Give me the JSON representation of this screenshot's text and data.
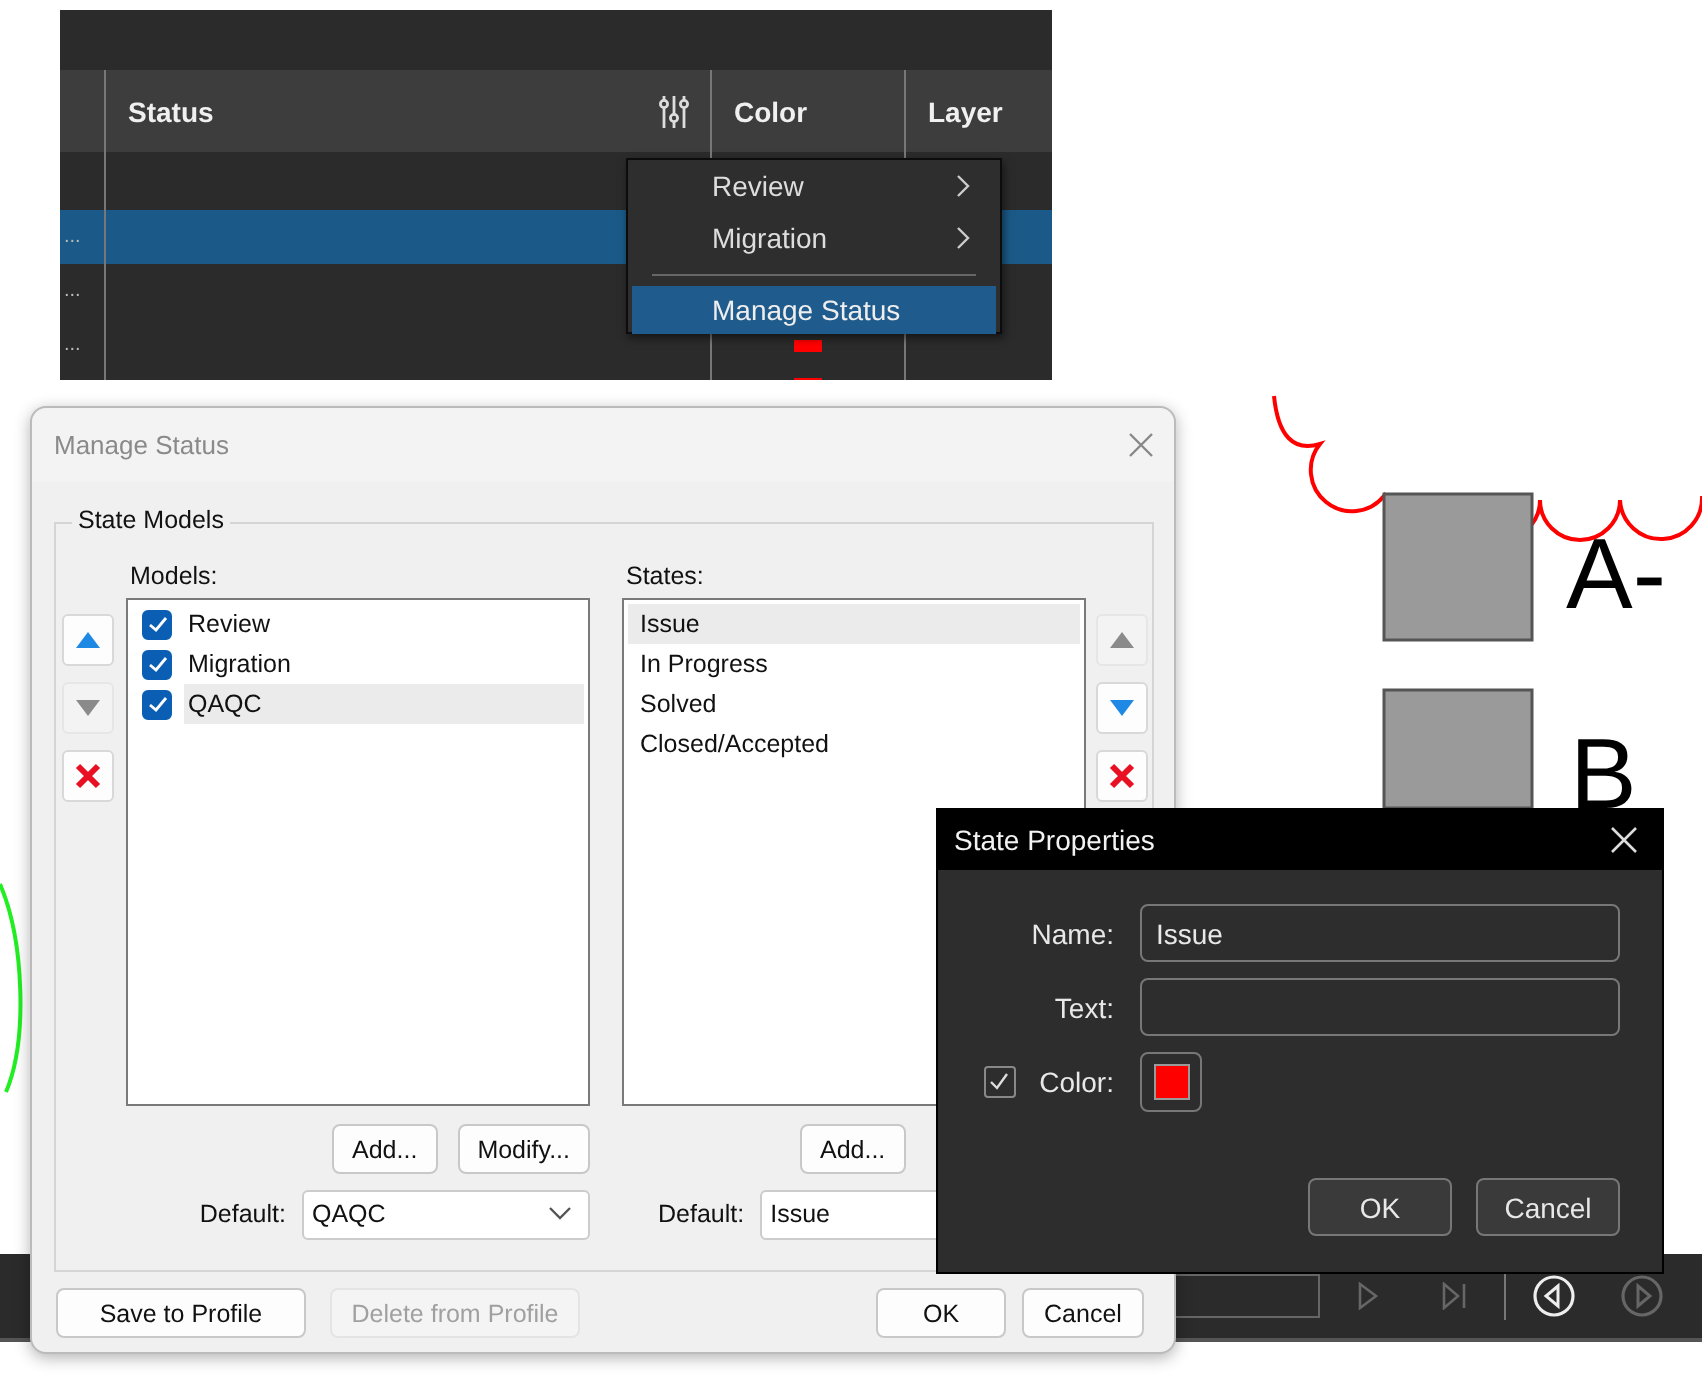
{
  "table": {
    "columns": [
      "Status",
      "Color",
      "Layer"
    ],
    "rows": [
      {
        "selected": false
      },
      {
        "column_1": "...",
        "selected": true
      },
      {
        "column_1": "...",
        "selected": false
      },
      {
        "column_1": "...",
        "selected": false,
        "color": "#ff0000"
      },
      {
        "selected": false,
        "color": "#ff0000"
      }
    ]
  },
  "context_menu": {
    "items": [
      {
        "label": "Review",
        "kind": "submenu",
        "selected": false
      },
      {
        "label": "Migration",
        "kind": "submenu",
        "selected": false
      },
      {
        "label": "Manage Status",
        "kind": "command",
        "selected": true
      }
    ]
  },
  "canvas": {
    "labels": [
      "A-",
      "B"
    ]
  },
  "manage_status": {
    "title": "Manage Status",
    "group": "State Models",
    "models_label": "Models:",
    "models": [
      {
        "label": "Review",
        "checked": true,
        "selected": false
      },
      {
        "label": "Migration",
        "checked": true,
        "selected": false
      },
      {
        "label": "QAQC",
        "checked": true,
        "selected": true
      }
    ],
    "model_buttons": [
      {
        "kind": "up",
        "disabled": false
      },
      {
        "kind": "down",
        "disabled": true
      },
      {
        "kind": "delete",
        "disabled": false
      }
    ],
    "states_label": "States:",
    "states": [
      {
        "label": "Issue",
        "selected": true
      },
      {
        "label": "In Progress",
        "selected": false
      },
      {
        "label": "Solved",
        "selected": false
      },
      {
        "label": "Closed/Accepted",
        "selected": false
      }
    ],
    "state_buttons": [
      {
        "kind": "up",
        "disabled": true
      },
      {
        "kind": "down",
        "disabled": false
      },
      {
        "kind": "delete",
        "disabled": false
      }
    ],
    "model_actions": [
      "Add...",
      "Modify..."
    ],
    "state_actions": [
      "Add..."
    ],
    "models_default": {
      "label": "Default:",
      "value": "QAQC"
    },
    "states_default": {
      "label": "Default:",
      "value": "Issue"
    },
    "footer_buttons": [
      {
        "label": "Save to Profile",
        "disabled": false
      },
      {
        "label": "Delete from Profile",
        "disabled": true
      },
      {
        "label": "OK",
        "disabled": false
      },
      {
        "label": "Cancel",
        "disabled": false
      }
    ]
  },
  "state_properties": {
    "title": "State Properties",
    "name_label": "Name:",
    "name_value": "Issue",
    "text_label": "Text:",
    "color_label": "Color:",
    "color_enabled": true,
    "color": "#ff0000",
    "buttons": [
      "OK",
      "Cancel"
    ]
  }
}
